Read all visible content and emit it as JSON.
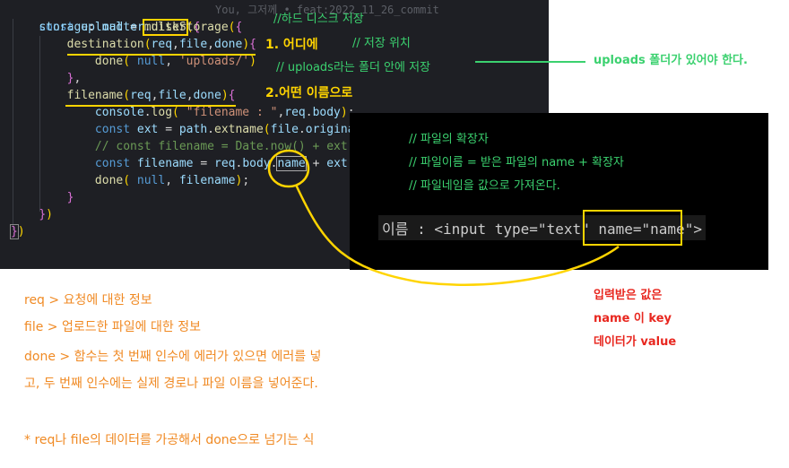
{
  "editor": {
    "lines": [
      "const upload = multer({",
      "    storage: multer.diskStorage({",
      "        destination(req,file,done){",
      "            done( null, 'uploads/')",
      "        },",
      "        filename(req,file,done){",
      "            console.log( \"filename : \",req.body);",
      "            const ext = path.extname(file.originalname);",
      "            // const filename = Date.now() + ext;",
      "            const filename = req.body.name + ext;",
      "            done( null, filename);",
      "        }",
      "    })",
      "})"
    ],
    "git_blame": "You, 그저께 • feat:2022_11_26_commit"
  },
  "annotations": {
    "disk_storage": "//하드 디스크 저장",
    "where": "1. 어디에",
    "save_location": "// 저장 위치",
    "uploads_folder": "// uploads라는 폴더 안에 저장",
    "uploads_required": "uploads 폴더가 있어야 한다.",
    "which_name": "2.어떤 이름으로"
  },
  "panel": {
    "comments": [
      "// 파일의 확장자",
      "// 파일이름 = 받은 파일의  name + 확장자",
      "// 파일네임을 값으로 가져온다."
    ],
    "input_line": "이름 : <input type=\"text\" name=\"name\">"
  },
  "notes": {
    "lines": [
      "req > 요청에 대한 정보",
      "file > 업로드한 파일에 대한 정보",
      "done > 함수는 첫 번째 인수에 에러가 있으면 에러를 넣",
      "고, 두 번째 인수에는 실제 경로나 파일 이름을 넣어준다.",
      "* req나 file의 데이터를 가공해서 done으로 넘기는 식"
    ]
  },
  "side_note": {
    "lines": [
      "입력받은 값은",
      "name 이 key",
      "데이터가 value"
    ]
  },
  "colors": {
    "editor_bg": "#1e1f24",
    "annotation_green": "#3bd16f",
    "annotation_yellow": "#ffd400",
    "notes_orange": "#f08a24",
    "side_red": "#e8271f"
  }
}
